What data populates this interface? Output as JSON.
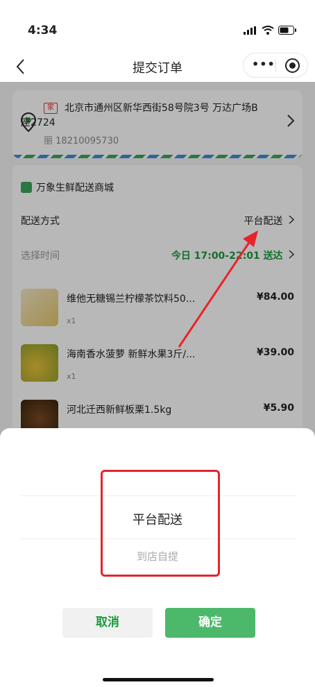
{
  "status_bar": {
    "time": "4:34"
  },
  "nav": {
    "title": "提交订单",
    "more": "•••"
  },
  "address": {
    "tag": "家",
    "line1": "北京市通州区新华西街58号院3号 万达广场B",
    "line2": "座2724",
    "contact": "丽 18210095730"
  },
  "shop": {
    "name": "万象生鲜配送商城"
  },
  "delivery": {
    "label": "配送方式",
    "value": "平台配送"
  },
  "time_select": {
    "label": "选择时间",
    "value": "今日 17:00-22:01 送达"
  },
  "items": [
    {
      "name": "维他无糖锡兰柠檬茶饮料50...",
      "price": "¥84.00",
      "qty": "x1"
    },
    {
      "name": "海南香水菠萝 新鲜水果3斤/...",
      "price": "¥39.00",
      "qty": "x1"
    },
    {
      "name": "河北迁西新鲜板栗1.5kg",
      "price": "¥5.90",
      "qty": ""
    }
  ],
  "sheet": {
    "options": [
      "平台配送",
      "到店自提"
    ],
    "selected": "平台配送",
    "cancel": "取消",
    "confirm": "确定"
  },
  "colors": {
    "accent_green": "#4cb86a",
    "annotation_red": "#e8232a"
  }
}
